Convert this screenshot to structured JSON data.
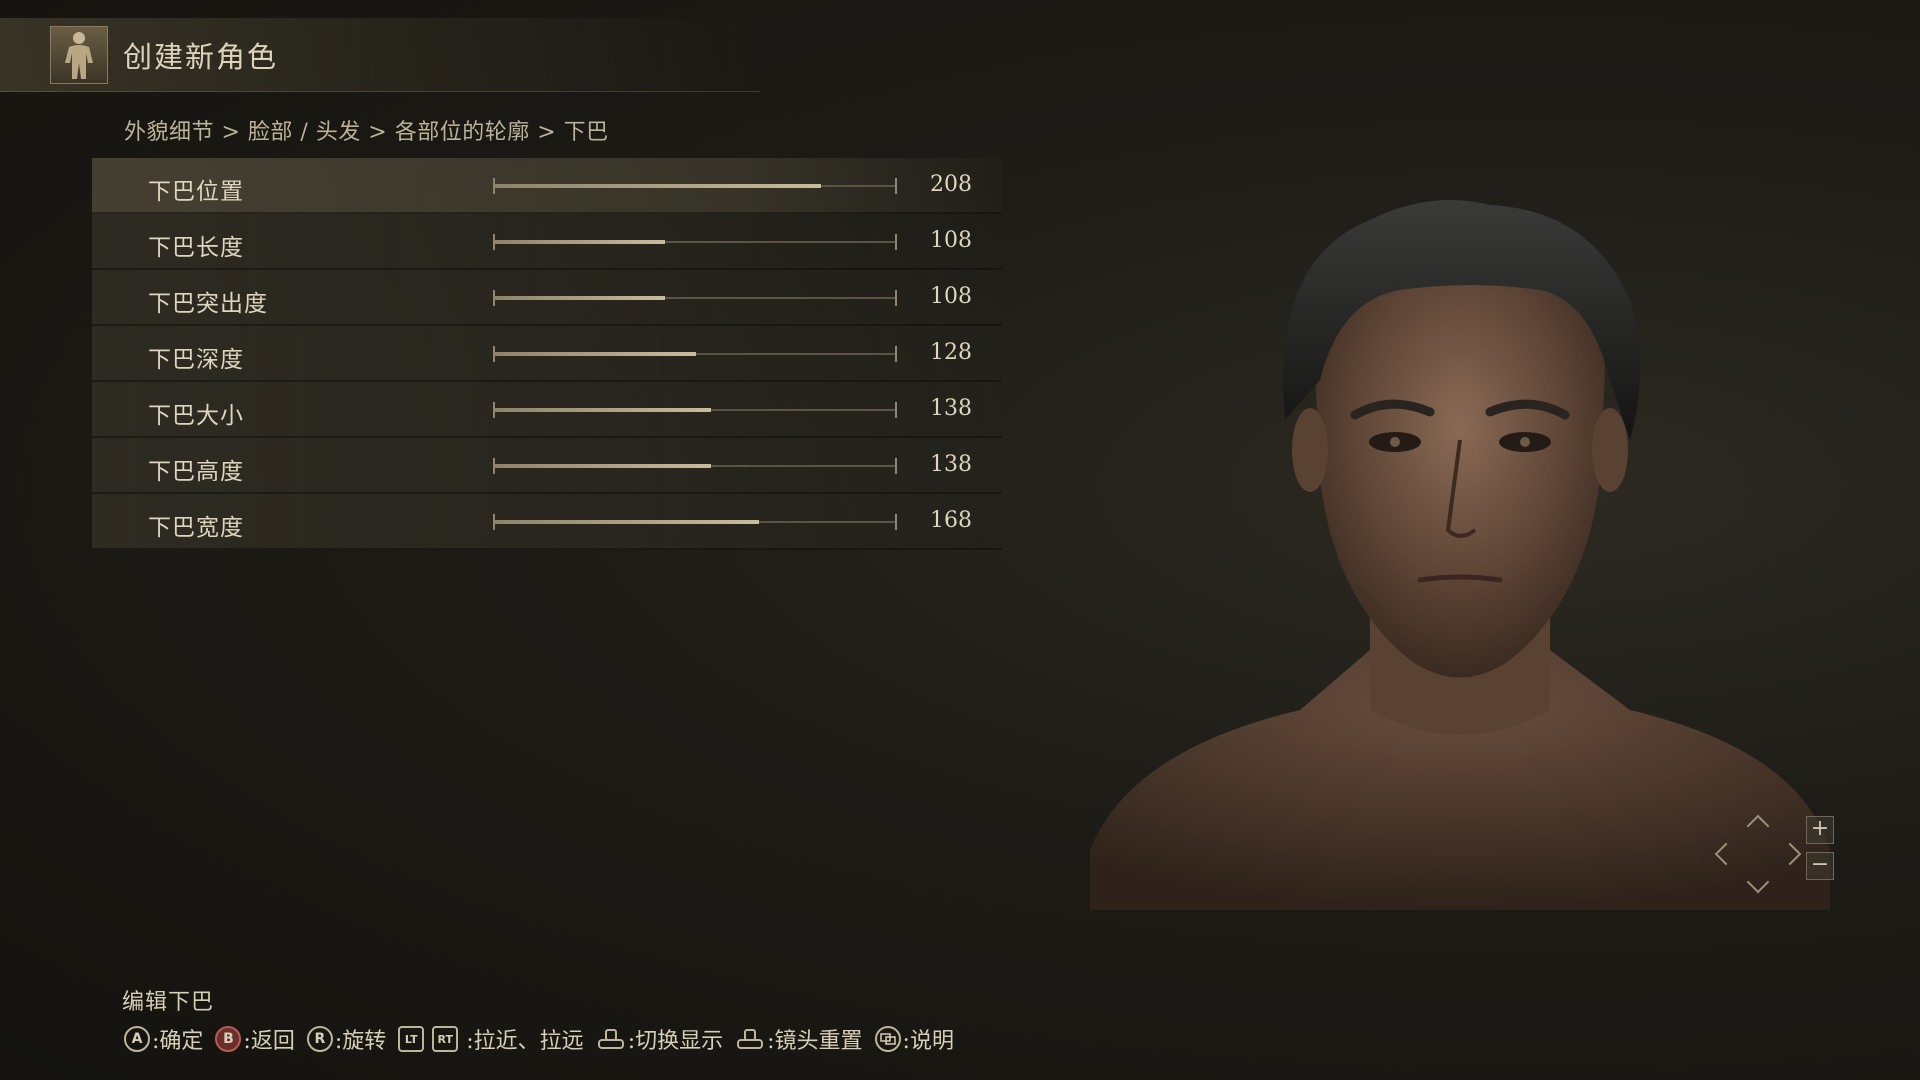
{
  "header": {
    "title": "创建新角色",
    "icon": "character-body-icon"
  },
  "breadcrumb": "外貌细节 > 脸部 / 头发 > 各部位的轮廓 > 下巴",
  "sliders": [
    {
      "label": "下巴位置",
      "value": "208",
      "level": 0.816,
      "selected": true
    },
    {
      "label": "下巴长度",
      "value": "108",
      "level": 0.424
    },
    {
      "label": "下巴突出度",
      "value": "108",
      "level": 0.424
    },
    {
      "label": "下巴深度",
      "value": "128",
      "level": 0.502
    },
    {
      "label": "下巴大小",
      "value": "138",
      "level": 0.541
    },
    {
      "label": "下巴高度",
      "value": "138",
      "level": 0.541
    },
    {
      "label": "下巴宽度",
      "value": "168",
      "level": 0.659
    }
  ],
  "camera": {
    "zoom_in": "+",
    "zoom_out": "−"
  },
  "footer": {
    "title": "编辑下巴",
    "hints": [
      {
        "button": "A",
        "label": ":确定"
      },
      {
        "button": "B",
        "label": ":返回"
      },
      {
        "button": "R",
        "label": ":旋转"
      },
      {
        "button": "LT",
        "label": ""
      },
      {
        "button": "RT",
        "label": ":拉近、拉远"
      },
      {
        "button": "LS",
        "label": ":切换显示"
      },
      {
        "button": "RS",
        "label": ":镜头重置"
      },
      {
        "button": "VIEW",
        "label": ":说明"
      }
    ]
  },
  "colors": {
    "accent": "#c8bd9a",
    "text": "#d4ccb6",
    "background": "#1d1b16"
  }
}
